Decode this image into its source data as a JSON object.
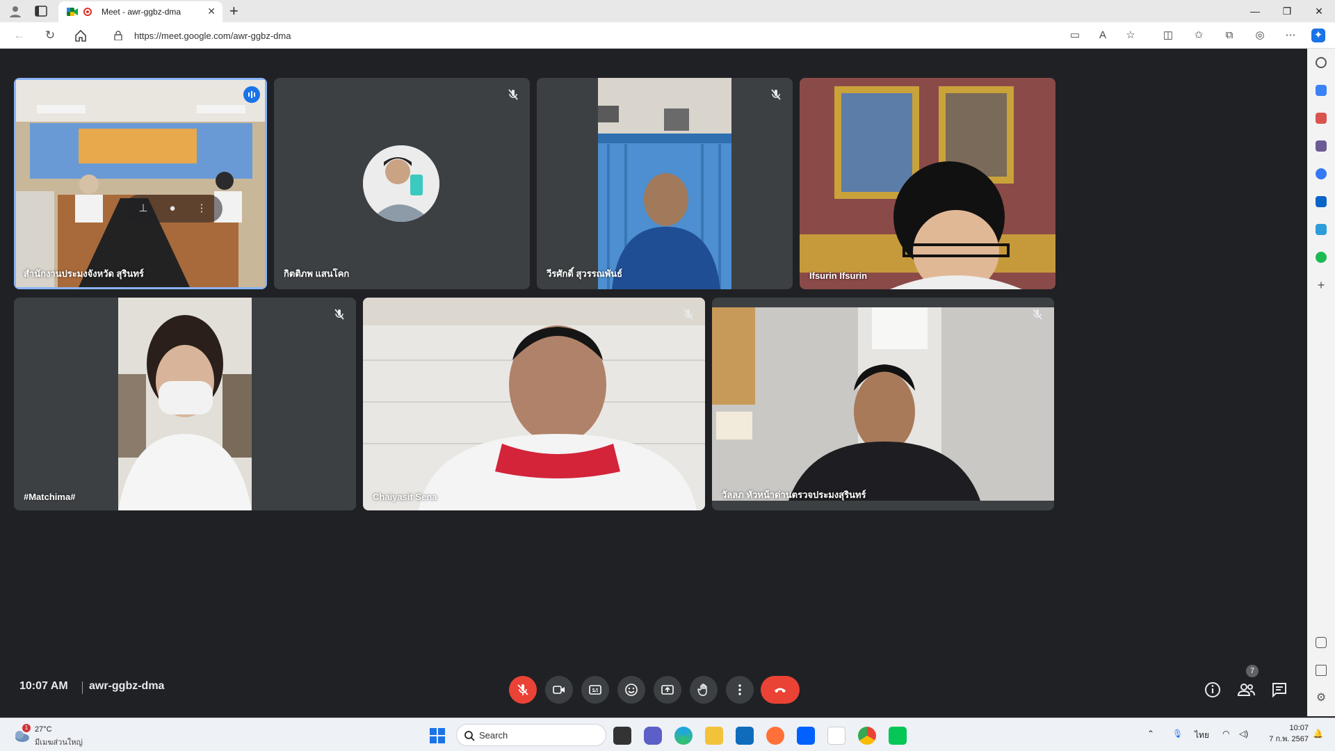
{
  "browser": {
    "tab_title": "Meet - awr-ggbz-dma",
    "url": "https://meet.google.com/awr-ggbz-dma"
  },
  "meet": {
    "time": "10:07 AM",
    "meeting_code": "awr-ggbz-dma",
    "people_count": "7",
    "participants": [
      {
        "name": "สำนักงานประมงจังหวัด สุรินทร์",
        "muted": false,
        "speaking": true
      },
      {
        "name": "กิตติภพ แสนโคก",
        "muted": true
      },
      {
        "name": "วีรศักดิ์ สุวรรณพันธ์",
        "muted": true
      },
      {
        "name": "Ifsurin Ifsurin",
        "muted": false
      },
      {
        "name": "#Matchima#",
        "muted": true
      },
      {
        "name": "Chaiyasit Sena",
        "muted": true
      },
      {
        "name": "วัลลภ หัวหน้าด่านตรวจประมงสุรินทร์",
        "muted": true
      }
    ],
    "colors": {
      "accent": "#8ab4f8",
      "end_call": "#ea4335",
      "background": "#202124",
      "tile": "#3c4043"
    }
  },
  "taskbar": {
    "weather_temp": "27°C",
    "weather_condition": "มีเมฆส่วนใหญ่",
    "weather_badge": "1",
    "search_label": "Search",
    "language": "ไทย",
    "time": "10:07",
    "date": "7 ก.พ. 2567"
  }
}
